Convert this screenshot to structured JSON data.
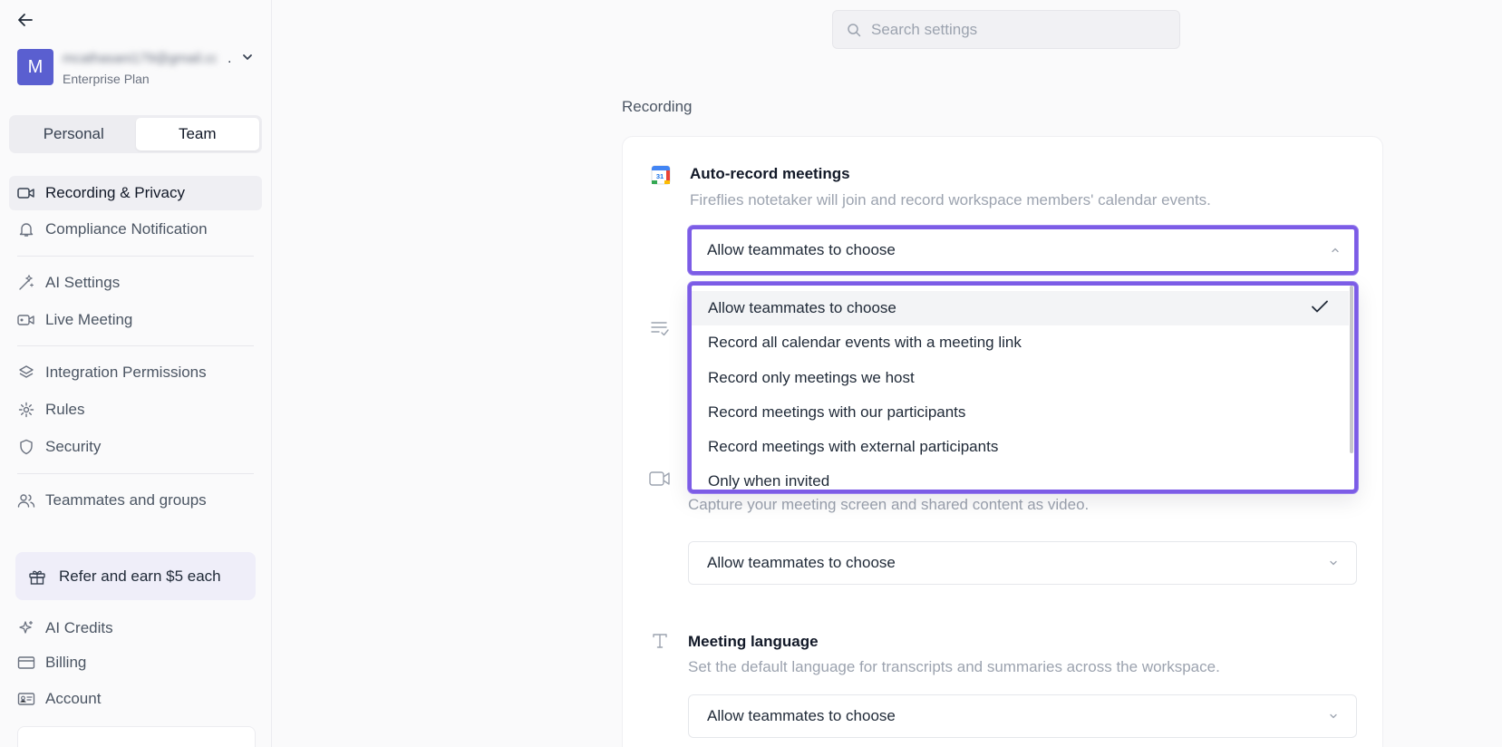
{
  "sidebar": {
    "account": {
      "avatar_letter": "M",
      "email": "mcathasani179@gmail.com",
      "ellipsis": ".",
      "plan": "Enterprise Plan"
    },
    "tabs": [
      {
        "label": "Personal",
        "active": false
      },
      {
        "label": "Team",
        "active": true
      }
    ],
    "items": [
      {
        "label": "Recording & Privacy",
        "icon": "video-camera-icon",
        "active": true
      },
      {
        "label": "Compliance Notification",
        "icon": "bell-icon"
      },
      {
        "label": "AI Settings",
        "icon": "magic-wand-icon"
      },
      {
        "label": "Live Meeting",
        "icon": "live-video-icon"
      },
      {
        "label": "Integration Permissions",
        "icon": "layers-icon"
      },
      {
        "label": "Rules",
        "icon": "cog-rules-icon"
      },
      {
        "label": "Security",
        "icon": "shield-icon"
      },
      {
        "label": "Teammates and groups",
        "icon": "users-icon"
      }
    ],
    "refer": {
      "label": "Refer and earn $5 each",
      "icon": "gift-icon"
    },
    "bottom_items": [
      {
        "label": "AI Credits",
        "icon": "sparkle-icon"
      },
      {
        "label": "Billing",
        "icon": "credit-card-icon"
      },
      {
        "label": "Account",
        "icon": "id-card-icon"
      }
    ]
  },
  "search": {
    "placeholder": "Search settings",
    "value": ""
  },
  "main": {
    "section_title": "Recording",
    "auto_record": {
      "title": "Auto-record meetings",
      "description": "Fireflies notetaker will join and record workspace members' calendar events.",
      "selected": "Allow teammates to choose",
      "options": [
        "Allow teammates to choose",
        "Record all calendar events with a meeting link",
        "Record only meetings we host",
        "Record meetings with our participants",
        "Record meetings with external participants",
        "Only when invited"
      ]
    },
    "video_recording": {
      "description": "Capture your meeting screen and shared content as video.",
      "selected": "Allow teammates to choose"
    },
    "meeting_language": {
      "title": "Meeting language",
      "description": "Set the default language for transcripts and summaries across the workspace.",
      "selected": "Allow teammates to choose"
    }
  },
  "colors": {
    "accent": "#7c5ce6",
    "avatar": "#5a5fd0",
    "refer_bg": "#efeef9"
  }
}
